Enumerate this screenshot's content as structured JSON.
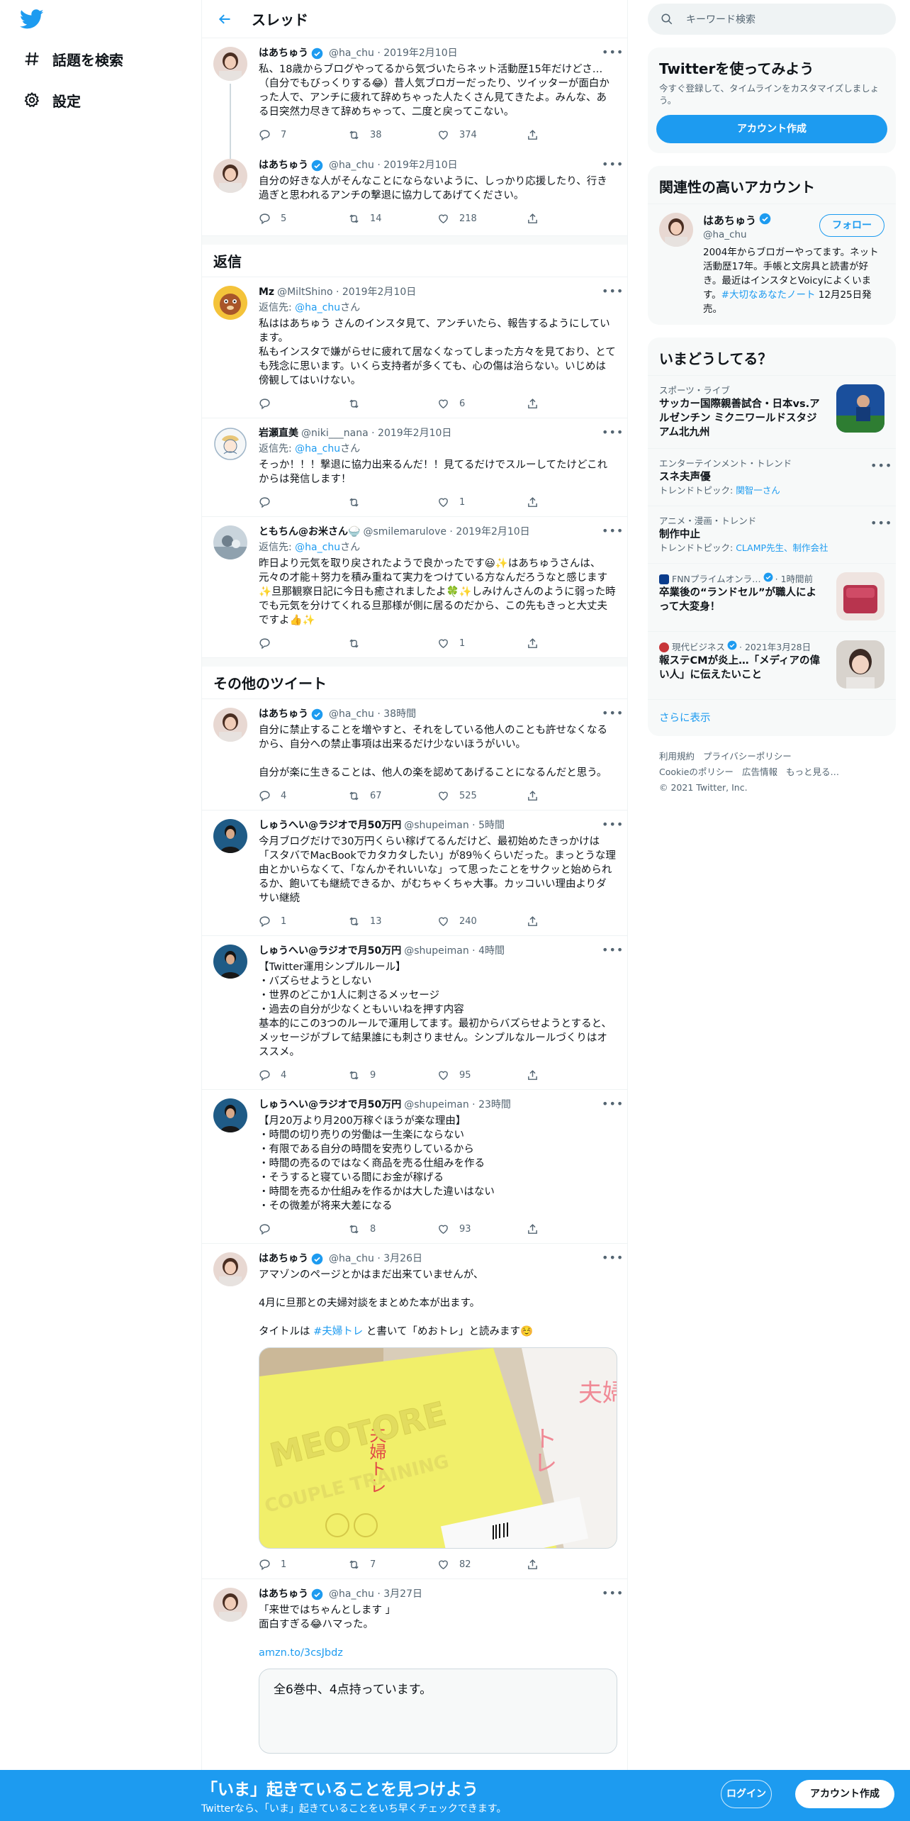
{
  "nav": {
    "explore_label": "話題を検索",
    "settings_label": "設定"
  },
  "header": {
    "title": "スレッド"
  },
  "thread": [
    {
      "name": "はあちゅう",
      "handle": "@ha_chu",
      "date": "2019年2月10日",
      "text": "私、18歳からブログやってるから気づいたらネット活動歴15年だけどさ…（自分でもびっくりする😂）昔人気ブロガーだったり、ツイッターが面白かった人で、アンチに疲れて辞めちゃった人たくさん見てきたよ。みんな、ある日突然力尽きて辞めちゃって、二度と戻ってこない。",
      "replies": "7",
      "retweets": "38",
      "likes": "374"
    },
    {
      "name": "はあちゅう",
      "handle": "@ha_chu",
      "date": "2019年2月10日",
      "text": "自分の好きな人がそんなことにならないように、しっかり応援したり、行き過ぎと思われるアンチの撃退に協力してあげてください。",
      "replies": "5",
      "retweets": "14",
      "likes": "218"
    }
  ],
  "replies_section": {
    "title": "返信",
    "reply_to_prefix": "返信先: ",
    "reply_to_handle": "@ha_chu",
    "reply_to_suffix": "さん",
    "items": [
      {
        "name": "Mz",
        "handle": "@MiltShino",
        "date": "2019年2月10日",
        "text": "私ははあちゅう さんのインスタ見て、アンチいたら、報告するようにしています。\n私もインスタで嫌がらせに疲れて居なくなってしまった方々を見ており、とても残念に思います。いくら支持者が多くても、心の傷は治らない。いじめは傍観してはいけない。",
        "replies": "",
        "retweets": "",
        "likes": "6"
      },
      {
        "name": "岩瀬直美",
        "handle": "@niki___nana",
        "date": "2019年2月10日",
        "text": "そっか！！！撃退に協力出来るんだ！！見てるだけでスルーしてたけどこれからは発信します！",
        "replies": "",
        "retweets": "",
        "likes": "1"
      },
      {
        "name": "ともちん@お米さん🍚",
        "handle": "@smilemarulove",
        "date": "2019年2月10日",
        "text": "昨日より元気を取り戻されたようで良かったです😃✨はあちゅうさんは、元々の才能＋努力を積み重ねて実力をつけている方なんだろうなと感じます✨旦那観察日記に今日も癒されましたよ🍀✨しみけんさんのように弱った時でも元気を分けてくれる旦那様が側に居るのだから、この先もきっと大丈夫ですよ👍✨",
        "replies": "",
        "retweets": "",
        "likes": "1"
      }
    ]
  },
  "other_section": {
    "title": "その他のツイート",
    "items": [
      {
        "name": "はあちゅう",
        "handle": "@ha_chu",
        "date": "38時間",
        "text": "自分に禁止することを増やすと、それをしている他人のことも許せなくなるから、自分への禁止事項は出来るだけ少ないほうがいい。\n\n自分が楽に生きることは、他人の楽を認めてあげることになるんだと思う。",
        "replies": "4",
        "retweets": "67",
        "likes": "525"
      },
      {
        "name": "しゅうへい@ラジオで月50万円",
        "handle": "@shupeiman",
        "date": "5時間",
        "text": "今月ブログだけで30万円くらい稼げてるんだけど、最初始めたきっかけは「スタバでMacBookでカタカタしたい」が89％くらいだった。まっとうな理由とかいらなくて、「なんかそれいいな」って思ったことをサクッと始められるか、飽いても継続できるか、がむちゃくちゃ大事。カッコいい理由よりダサい継続",
        "replies": "1",
        "retweets": "13",
        "likes": "240"
      },
      {
        "name": "しゅうへい@ラジオで月50万円",
        "handle": "@shupeiman",
        "date": "4時間",
        "text": "【Twitter運用シンプルルール】\n・バズらせようとしない\n・世界のどこか1人に刺さるメッセージ\n・過去の自分が少なくともいいねを押す内容\n基本的にこの3つのルールで運用してます。最初からバズらせようとすると、メッセージがブレて結果誰にも刺さりません。シンプルなルールづくりはオススメ。",
        "replies": "4",
        "retweets": "9",
        "likes": "95"
      },
      {
        "name": "しゅうへい@ラジオで月50万円",
        "handle": "@shupeiman",
        "date": "23時間",
        "text": "【月20万より月200万稼ぐほうが楽な理由】\n・時間の切り売りの労働は一生楽にならない\n・有限である自分の時間を安売りしているから\n・時間の売るのではなく商品を売る仕組みを作る\n・そうすると寝ている間にお金が稼げる\n・時間を売るか仕組みを作るかは大した違いはない\n・その微差が将来大差になる",
        "replies": "",
        "retweets": "8",
        "likes": "93"
      },
      {
        "name": "はあちゅう",
        "handle": "@ha_chu",
        "date": "3月26日",
        "text_a": "アマゾンのページとかはまだ出来ていませんが、\n\n4月に旦那との夫婦対談をまとめた本が出ます。\n\nタイトルは ",
        "hashtag": "#夫婦トレ",
        "text_b": " と書いて「めおトレ」と読みます☺️",
        "media_text_1": "夫婦トレ",
        "media_text_2": "MEOTORE",
        "media_text_3": "COUPLE TRAINING",
        "media_text_4": "夫婦",
        "media_text_5": "トレ",
        "replies": "1",
        "retweets": "7",
        "likes": "82"
      },
      {
        "name": "はあちゅう",
        "handle": "@ha_chu",
        "date": "3月27日",
        "text": "「来世ではちゃんとします 」\n面白すぎる😂ハマった。",
        "link": "amzn.to/3csJbdz",
        "card_text": "全6巻中、4点持っています。"
      }
    ]
  },
  "right": {
    "search_placeholder": "キーワード検索",
    "join": {
      "title": "Twitterを使ってみよう",
      "subtitle": "今すぐ登録して、タイムラインをカスタマイズしましょう。",
      "button": "アカウント作成"
    },
    "related": {
      "title": "関連性の高いアカウント",
      "name": "はあちゅう",
      "handle": "@ha_chu",
      "follow": "フォロー",
      "bio_a": "2004年からブロガーやってます。ネット活動歴17年。手帳と文房具と読書が好き。最近はインスタとVoicyによくいます。",
      "bio_link": "#大切なあなたノート",
      "bio_b": " 12月25日発売。"
    },
    "trends": {
      "title": "いまどうしてる？",
      "items": [
        {
          "cat": "スポーツ・ライブ",
          "title": "サッカー国際親善試合・日本vs.アルゼンチン ミクニワールドスタジアム北九州"
        },
        {
          "cat": "エンターテインメント・トレンド",
          "title": "スネ夫声優",
          "sub_prefix": "トレンドトピック: ",
          "sub": "関智一さん"
        },
        {
          "cat": "アニメ・漫画・トレンド",
          "title": "制作中止",
          "sub_prefix": "トレンドトピック: ",
          "sub": "CLAMP先生、制作会社"
        },
        {
          "cat": "FNNプライムオンラ…",
          "time": "· 1時間前",
          "title": "卒業後の“ランドセル”が職人によって大変身！"
        },
        {
          "cat": "現代ビジネス",
          "time": "· 2021年3月28日",
          "title": "報ステCMが炎上…「メディアの偉い人」に伝えたいこと"
        }
      ],
      "more": "さらに表示"
    },
    "footer": {
      "links": [
        "利用規約",
        "プライバシーポリシー",
        "Cookieのポリシー",
        "広告情報",
        "もっと見る…"
      ],
      "copyright": "© 2021 Twitter, Inc."
    }
  },
  "bottombar": {
    "title": "「いま」起きていることを見つけよう",
    "subtitle": "Twitterなら、「いま」起きていることをいち早くチェックできます。",
    "login": "ログイン",
    "signup": "アカウント作成"
  },
  "colors": {
    "accent": "#1d9bf0",
    "text": "#0f1419",
    "muted": "#536471"
  }
}
